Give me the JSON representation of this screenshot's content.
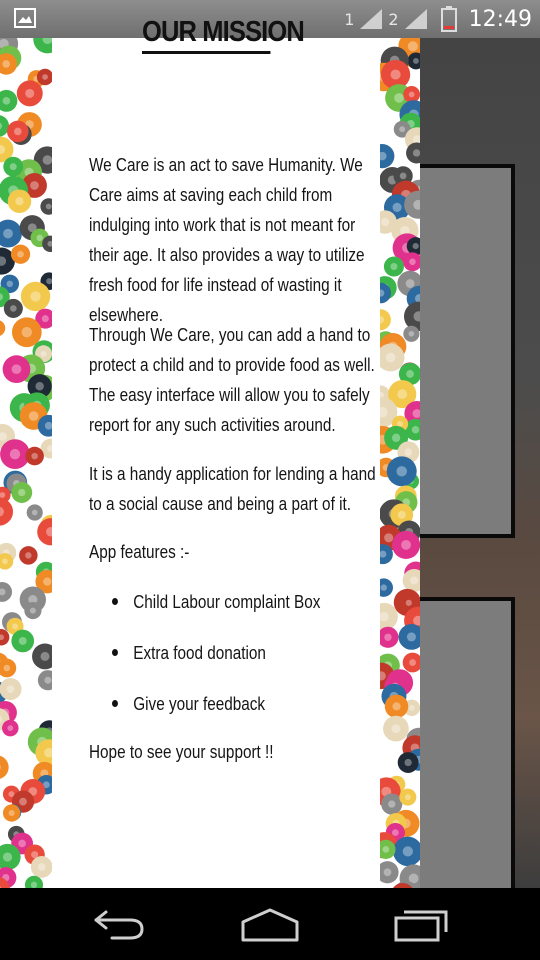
{
  "status_bar": {
    "sim1": "1",
    "sim2": "2",
    "time": "12:49",
    "icons": [
      "image-notification-icon",
      "signal-icon",
      "signal-icon",
      "battery-icon"
    ]
  },
  "mission": {
    "title": "OUR MISSION",
    "paragraphs": [
      "We Care is an act to save Humanity. We Care aims at saving each child from indulging into work that is not meant for their age. It also provides a way to utilize fresh food for life instead of wasting it elsewhere.",
      "Through We Care, you can add a hand to protect a child and to provide food as well. The easy interface will allow you to safely report for any such activities around.",
      "It is a handy application for lending a hand to a social cause and being a part of it."
    ],
    "features_heading": "App features :-",
    "features": [
      "Child Labour complaint Box",
      "Extra food donation",
      "Give your feedback"
    ],
    "closing": "Hope to see your support !!"
  },
  "nav_bar": {
    "icons": [
      "back-icon",
      "home-icon",
      "recents-icon"
    ]
  },
  "colors": {
    "status_bar": "#7a7a7a",
    "panel_bg": "#ffffff",
    "nav_bar": "#000000",
    "battery_low": "#e53935"
  }
}
